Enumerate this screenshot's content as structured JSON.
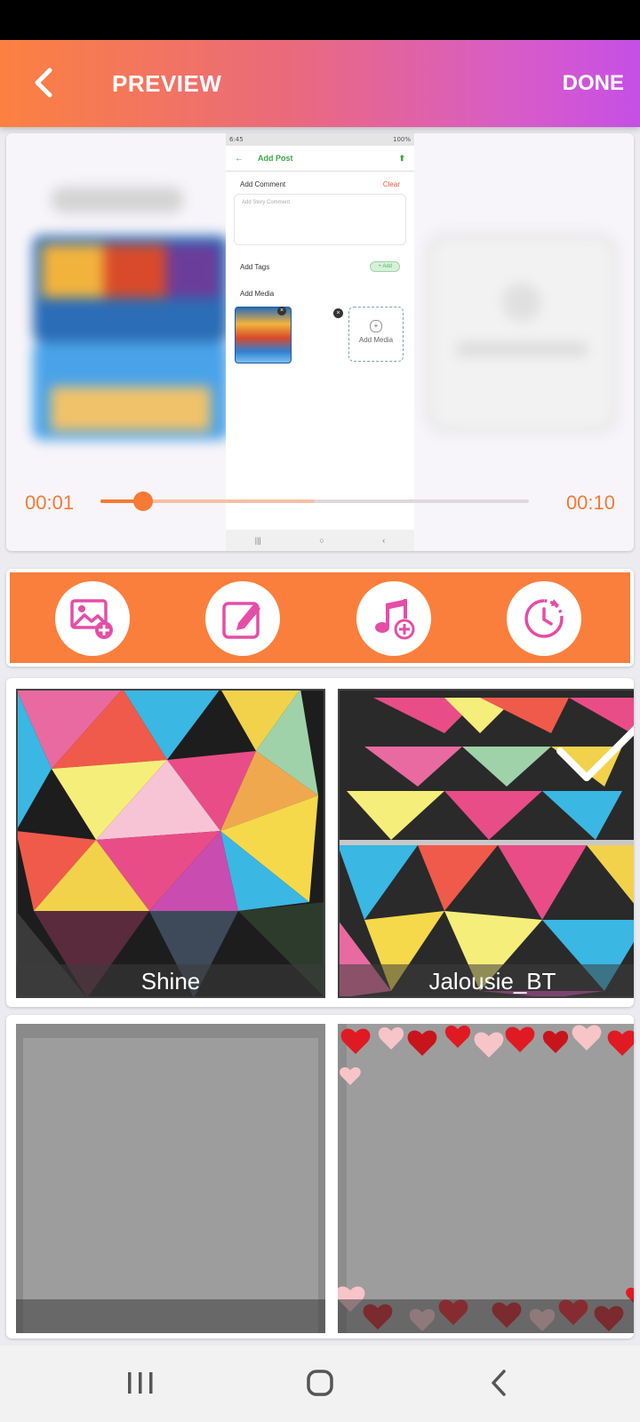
{
  "app_bar": {
    "title": "PREVIEW",
    "done_label": "DONE"
  },
  "player": {
    "current_time": "00:01",
    "total_time": "00:10",
    "progress": 0.1,
    "buffered": 0.5,
    "phone_preview": {
      "status_time": "6:45",
      "status_battery": "100%",
      "header_title": "Add Post",
      "comment_label": "Add Comment",
      "clear_label": "Clear",
      "comment_placeholder": "Add Story Comment",
      "tags_label": "Add Tags",
      "add_tag_label": "+ Add",
      "media_label": "Add Media",
      "add_media_label": "Add Media"
    }
  },
  "toolbar": {
    "icons": [
      "add-image-icon",
      "edit-icon",
      "add-music-icon",
      "duration-icon"
    ],
    "accent": "#fb7f3c",
    "icon_color": "#e54da6"
  },
  "frames": [
    {
      "label": "Shine",
      "selected": false
    },
    {
      "label": "Jalousie_BT",
      "selected": true
    },
    {
      "label": "",
      "selected": false
    },
    {
      "label": "",
      "selected": false
    }
  ],
  "colors": {
    "gradient_start": "#fb8140",
    "gradient_end": "#c64fe6",
    "time_text": "#f67a35"
  }
}
